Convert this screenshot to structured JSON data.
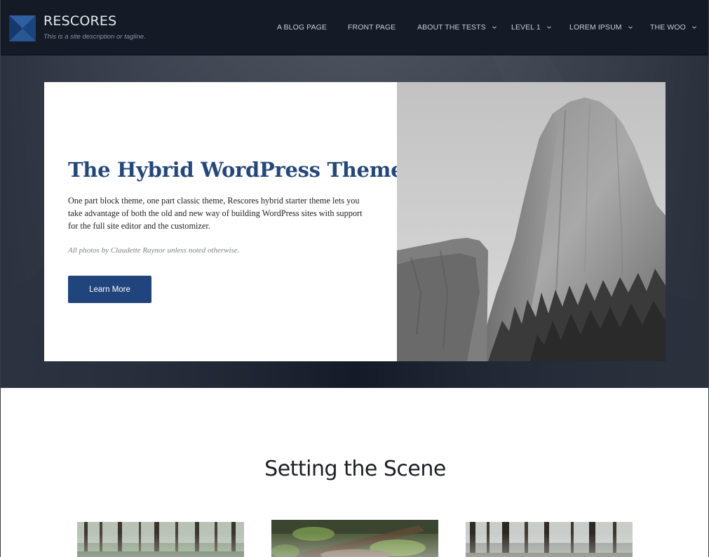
{
  "header": {
    "site_title": "RESCORES",
    "tagline": "This is a site description or tagline.",
    "logo_icon": "logo-mark-icon"
  },
  "nav": {
    "items": [
      {
        "label": "A BLOG PAGE",
        "has_dropdown": false
      },
      {
        "label": "FRONT PAGE",
        "has_dropdown": false
      },
      {
        "label": "ABOUT THE TESTS",
        "has_dropdown": true
      },
      {
        "label": "LEVEL 1",
        "has_dropdown": true
      },
      {
        "label": "LOREM IPSUM",
        "has_dropdown": true
      },
      {
        "label": "THE WOO",
        "has_dropdown": true
      }
    ]
  },
  "hero": {
    "title": "The Hybrid WordPress Theme",
    "text": "One part block theme, one part classic theme, Rescores hybrid starter theme lets you take advantage of both the old and new way of building WordPress sites with support for the full site editor and the customizer.",
    "credit": "All photos by Claudette Raynor unless noted otherwise.",
    "button_label": "Learn More"
  },
  "section": {
    "title": "Setting the Scene"
  },
  "colors": {
    "header_bg": "#141b27",
    "accent": "#22447c",
    "title_blue": "#24487c"
  }
}
